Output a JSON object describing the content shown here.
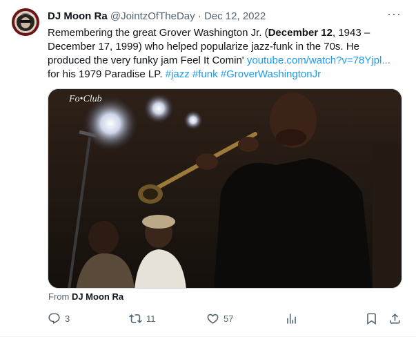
{
  "author": {
    "name": "DJ Moon Ra",
    "handle": "@JointzOfTheDay",
    "separator": "·",
    "date": "Dec 12, 2022"
  },
  "more_label": "···",
  "tweet": {
    "p1": "Remembering the great Grover Washington Jr. (",
    "b1": "December 12",
    "p2": ", 1943 – December 17, 1999) who helped popularize jazz-funk in the 70s. He produced the very funky jam Feel It Comin' ",
    "link": "youtube.com/watch?v=78Yjpl...",
    "p3": " for his 1979 Paradise LP. ",
    "tags": [
      "#jazz",
      "#funk",
      "#GroverWashingtonJr"
    ]
  },
  "media": {
    "overlay_text": "Fo•Club"
  },
  "attribution": {
    "prefix": "From ",
    "name": "DJ Moon Ra"
  },
  "actions": {
    "replies": "3",
    "reposts": "11",
    "likes": "57"
  },
  "colors": {
    "link": "#1d9bf0",
    "secondary": "#536471",
    "text": "#0f1419"
  }
}
